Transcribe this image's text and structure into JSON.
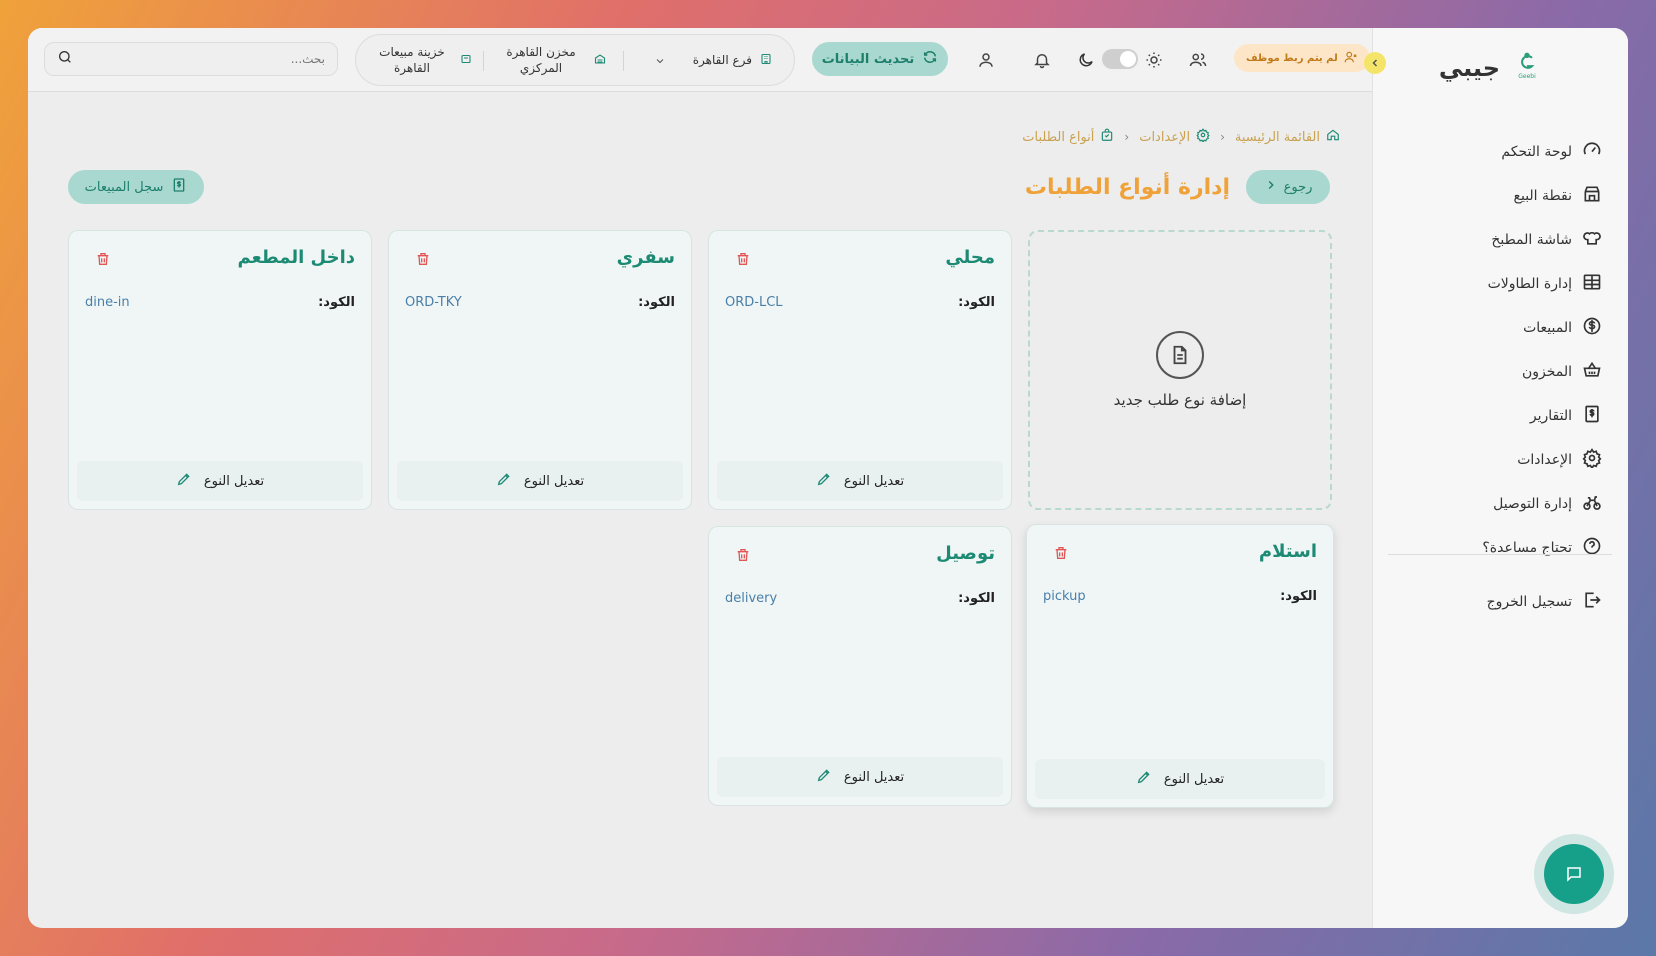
{
  "sidebar": {
    "logo_text": "جيبي",
    "logo_mark_text": "Geebi",
    "items": [
      {
        "label": "لوحة التحكم",
        "icon": "gauge-icon"
      },
      {
        "label": "نقطة البيع",
        "icon": "store-icon"
      },
      {
        "label": "شاشة المطبخ",
        "icon": "chef-hat-icon"
      },
      {
        "label": "إدارة الطاولات",
        "icon": "table-grid-icon"
      },
      {
        "label": "المبيعات",
        "icon": "dollar-circle-icon"
      },
      {
        "label": "المخزون",
        "icon": "basket-icon"
      },
      {
        "label": "التقارير",
        "icon": "report-dollar-icon"
      },
      {
        "label": "الإعدادات",
        "icon": "gear-icon"
      },
      {
        "label": "إدارة التوصيل",
        "icon": "bike-icon"
      },
      {
        "label": "تحتاج مساعدة؟",
        "icon": "help-circle-icon"
      }
    ],
    "logout_label": "تسجيل الخروج"
  },
  "header": {
    "no_employee_badge": "لم يتم ربط موظف",
    "refresh_label": "تحديث البيانات",
    "branch_label": "فرع القاهرة",
    "warehouse_label": "مخزن القاهرة المركزي",
    "treasury_label": "خزينة مبيعات القاهرة",
    "search_placeholder": "بحث..."
  },
  "breadcrumb": {
    "home": "القائمة الرئيسية",
    "settings": "الإعدادات",
    "current": "أنواع الطلبات"
  },
  "page": {
    "title": "إدارة أنواع الطلبات",
    "back_label": "رجوع",
    "sales_log_label": "سجل المبيعات",
    "add_card_label": "إضافة نوع طلب جديد",
    "code_label": "الكود:",
    "edit_label": "تعديل النوع"
  },
  "order_types": [
    {
      "name": "محلي",
      "code": "ORD-LCL"
    },
    {
      "name": "سفري",
      "code": "ORD-TKY"
    },
    {
      "name": "داخل المطعم",
      "code": "dine-in"
    },
    {
      "name": "استلام",
      "code": "pickup"
    },
    {
      "name": "توصيل",
      "code": "delivery"
    }
  ],
  "colors": {
    "accent_teal": "#1d8a74",
    "title_orange": "#f0a23a",
    "trash_red": "#e05555",
    "pill_teal_bg": "#a8d8cf"
  }
}
